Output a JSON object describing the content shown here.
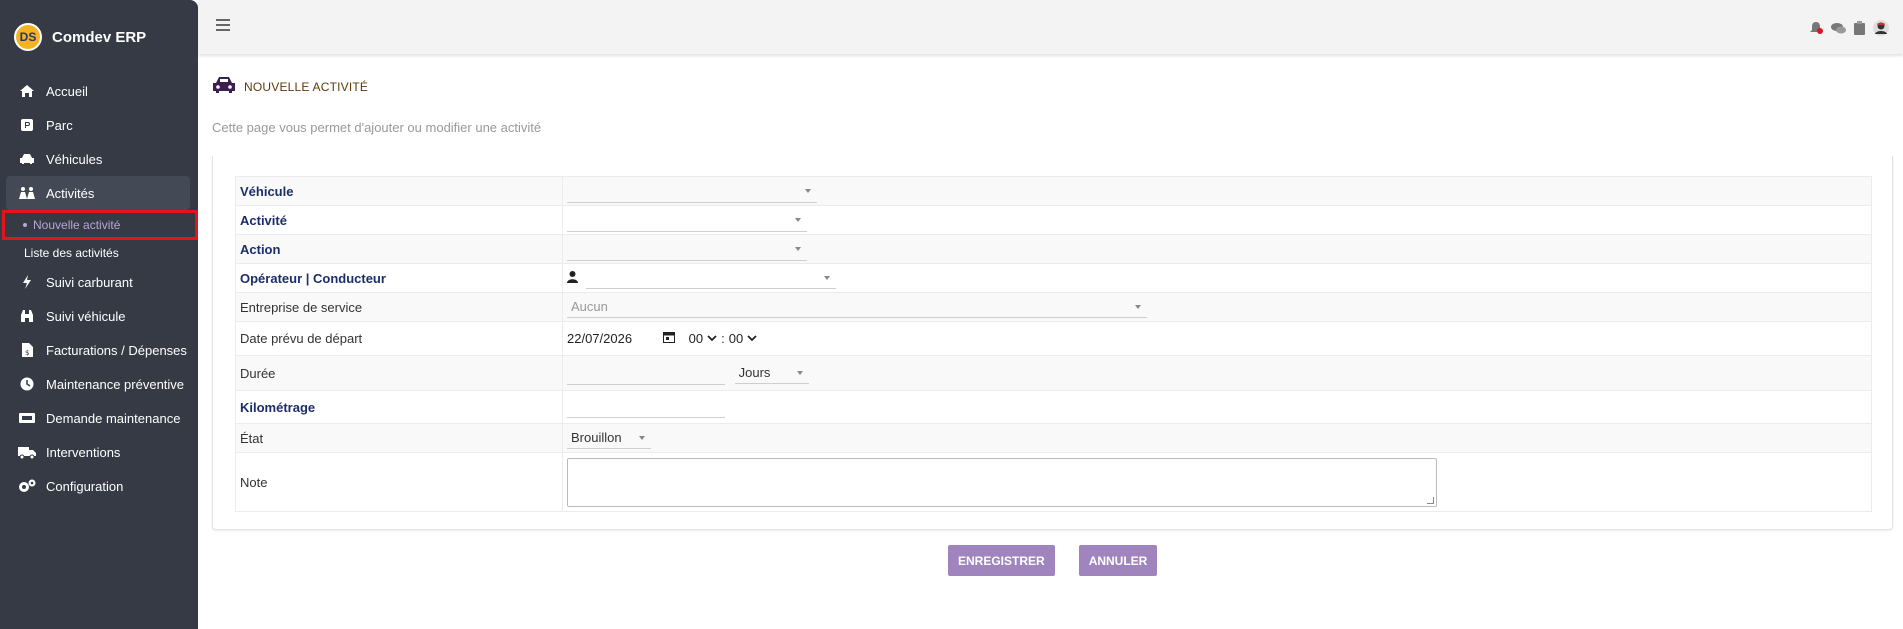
{
  "app": {
    "name": "Comdev ERP",
    "logo_text": "DS"
  },
  "sidebar": {
    "items": [
      {
        "label": "Accueil",
        "icon": "home-icon"
      },
      {
        "label": "Parc",
        "icon": "parking-icon"
      },
      {
        "label": "Véhicules",
        "icon": "car-icon"
      },
      {
        "label": "Activités",
        "icon": "activities-icon"
      },
      {
        "label": "Suivi carburant",
        "icon": "bolt-icon"
      },
      {
        "label": "Suivi véhicule",
        "icon": "binoculars-icon"
      },
      {
        "label": "Facturations / Dépenses",
        "icon": "invoice-icon"
      },
      {
        "label": "Maintenance préventive",
        "icon": "clock-icon"
      },
      {
        "label": "Demande maintenance",
        "icon": "ticket-icon"
      },
      {
        "label": "Interventions",
        "icon": "truck-icon"
      },
      {
        "label": "Configuration",
        "icon": "cogs-icon"
      }
    ],
    "subitems": [
      {
        "label": "Nouvelle activité"
      },
      {
        "label": "Liste des activités"
      }
    ]
  },
  "page": {
    "title": "NOUVELLE ACTIVITÉ",
    "description": "Cette page vous permet d'ajouter ou modifier une activité"
  },
  "form": {
    "vehicule_label": "Véhicule",
    "activite_label": "Activité",
    "action_label": "Action",
    "operateur_label": "Opérateur | Conducteur",
    "entreprise_label": "Entreprise de service",
    "entreprise_placeholder": "Aucun",
    "date_label": "Date prévu de départ",
    "date_value": "22/07/2026",
    "hour_value": "00",
    "minute_value": "00",
    "duree_label": "Durée",
    "duree_unit": "Jours",
    "km_label": "Kilométrage",
    "etat_label": "État",
    "etat_value": "Brouillon",
    "note_label": "Note"
  },
  "buttons": {
    "save": "ENREGISTRER",
    "cancel": "ANNULER"
  },
  "colors": {
    "sidebar": "#353a45",
    "accent": "#a084bd",
    "highlight": "#e0151d",
    "label": "#1c2d6b"
  }
}
